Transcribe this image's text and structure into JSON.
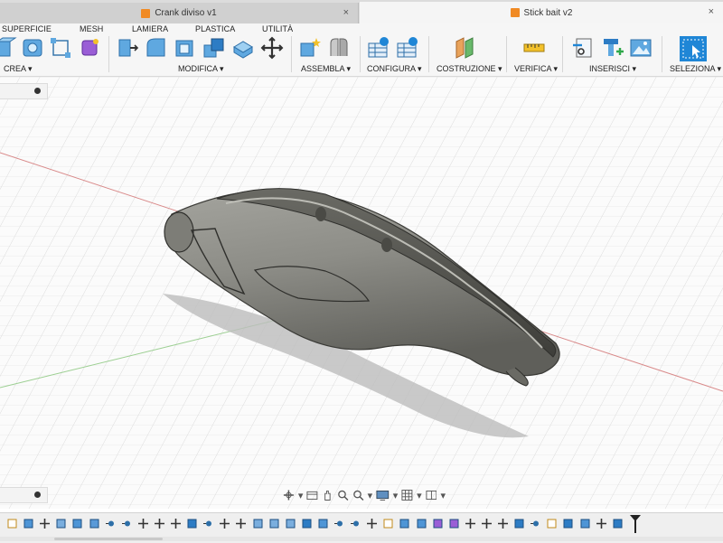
{
  "tabs": [
    {
      "label": "Crank diviso v1",
      "active": false
    },
    {
      "label": "Stick bait v2",
      "active": true
    }
  ],
  "ribbon": {
    "tab_names": [
      "SUPERFICIE",
      "MESH",
      "LAMIERA",
      "PLASTICA",
      "UTILITÀ"
    ],
    "groups": [
      "CREA",
      "MODIFICA",
      "ASSEMBLA",
      "CONFIGURA",
      "COSTRUZIONE",
      "VERIFICA",
      "INSERISCI",
      "SELEZIONA"
    ]
  },
  "colors": {
    "accent_orange": "#f08a24",
    "select_blue": "#1f86d6",
    "axis_red": "#d96a6a",
    "axis_green": "#7bbf6e",
    "model_gray": "#8c8c86"
  },
  "icons": {
    "close": "×",
    "dropdown": "▾"
  },
  "timeline": {
    "item_count": 38
  }
}
